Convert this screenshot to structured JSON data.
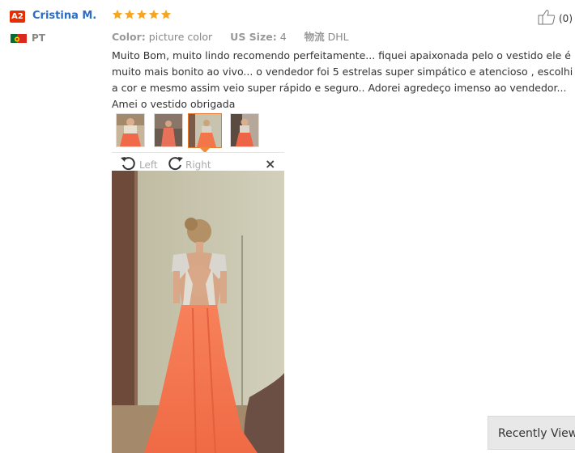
{
  "reviewer": {
    "level_badge": "A2",
    "name": "Cristina M.",
    "country_code": "PT",
    "flag": "portugal-flag-icon"
  },
  "rating": {
    "stars": 5,
    "max": 5,
    "color": "#f5a623"
  },
  "attributes": {
    "color_label": "Color:",
    "color_value": "picture color",
    "size_label": "US Size:",
    "size_value": "4",
    "shipping_label": "物流",
    "shipping_value": "DHL"
  },
  "helpful": {
    "icon": "thumbs-up-icon",
    "count": "(0)"
  },
  "review_text": "Muito Bom, muito lindo recomendo perfeitamente... fiquei apaixonada pelo o vestido ele é muito mais bonito ao vivo... o vendedor foi 5 estrelas super simpático e atencioso , escolhi a cor e mesmo assim veio super rápido e seguro.. Adorei agredeço imenso ao vendedor... Amei o vestido obrigada",
  "thumbnails": {
    "count": 4,
    "selected_index": 2,
    "accent": "#e87b2f"
  },
  "viewer": {
    "rotate_left_label": "Left",
    "rotate_right_label": "Right",
    "close_symbol": "×"
  },
  "recently_viewed": {
    "label": "Recently Viewed"
  }
}
